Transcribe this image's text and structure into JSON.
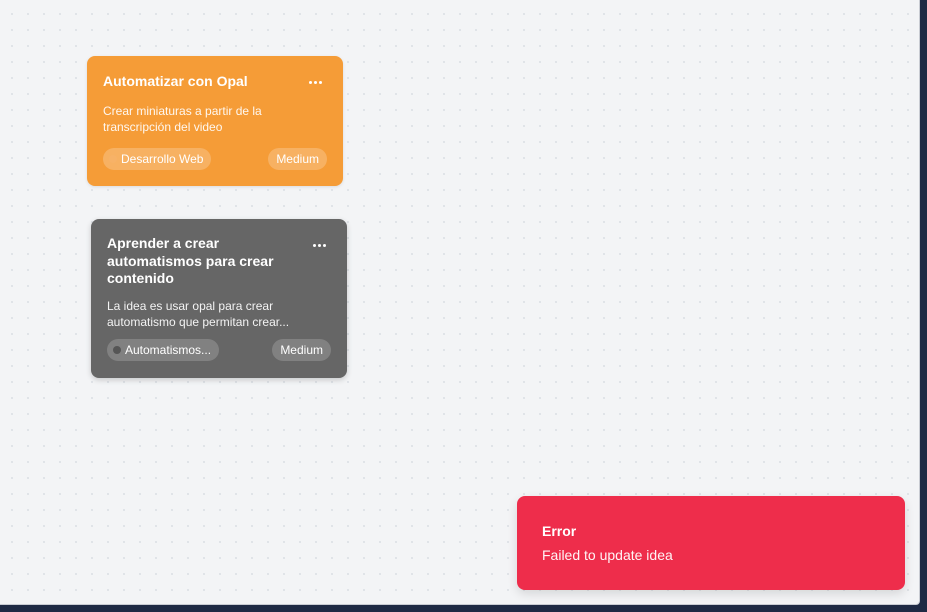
{
  "colors": {
    "canvas_bg": "#f3f4f6",
    "card_orange": "#f59c37",
    "card_gray": "#666666",
    "toast_error": "#ee2d4b"
  },
  "ideas": [
    {
      "title": "Automatizar con Opal",
      "description": "Crear miniaturas a partir de la transcripción del video",
      "category": "Desarrollo Web",
      "category_dot_color": "#f7b267",
      "priority": "Medium",
      "menu_icon": "more-horizontal-icon",
      "color": "#f59c37"
    },
    {
      "title": "Aprender a crear automatismos para crear contenido",
      "description": "La idea es usar opal para crear automatismo que permitan crear...",
      "category": "Automatismos...",
      "category_dot_color": "#555555",
      "priority": "Medium",
      "menu_icon": "more-horizontal-icon",
      "color": "#666666"
    }
  ],
  "toast": {
    "title": "Error",
    "message": "Failed to update idea"
  }
}
